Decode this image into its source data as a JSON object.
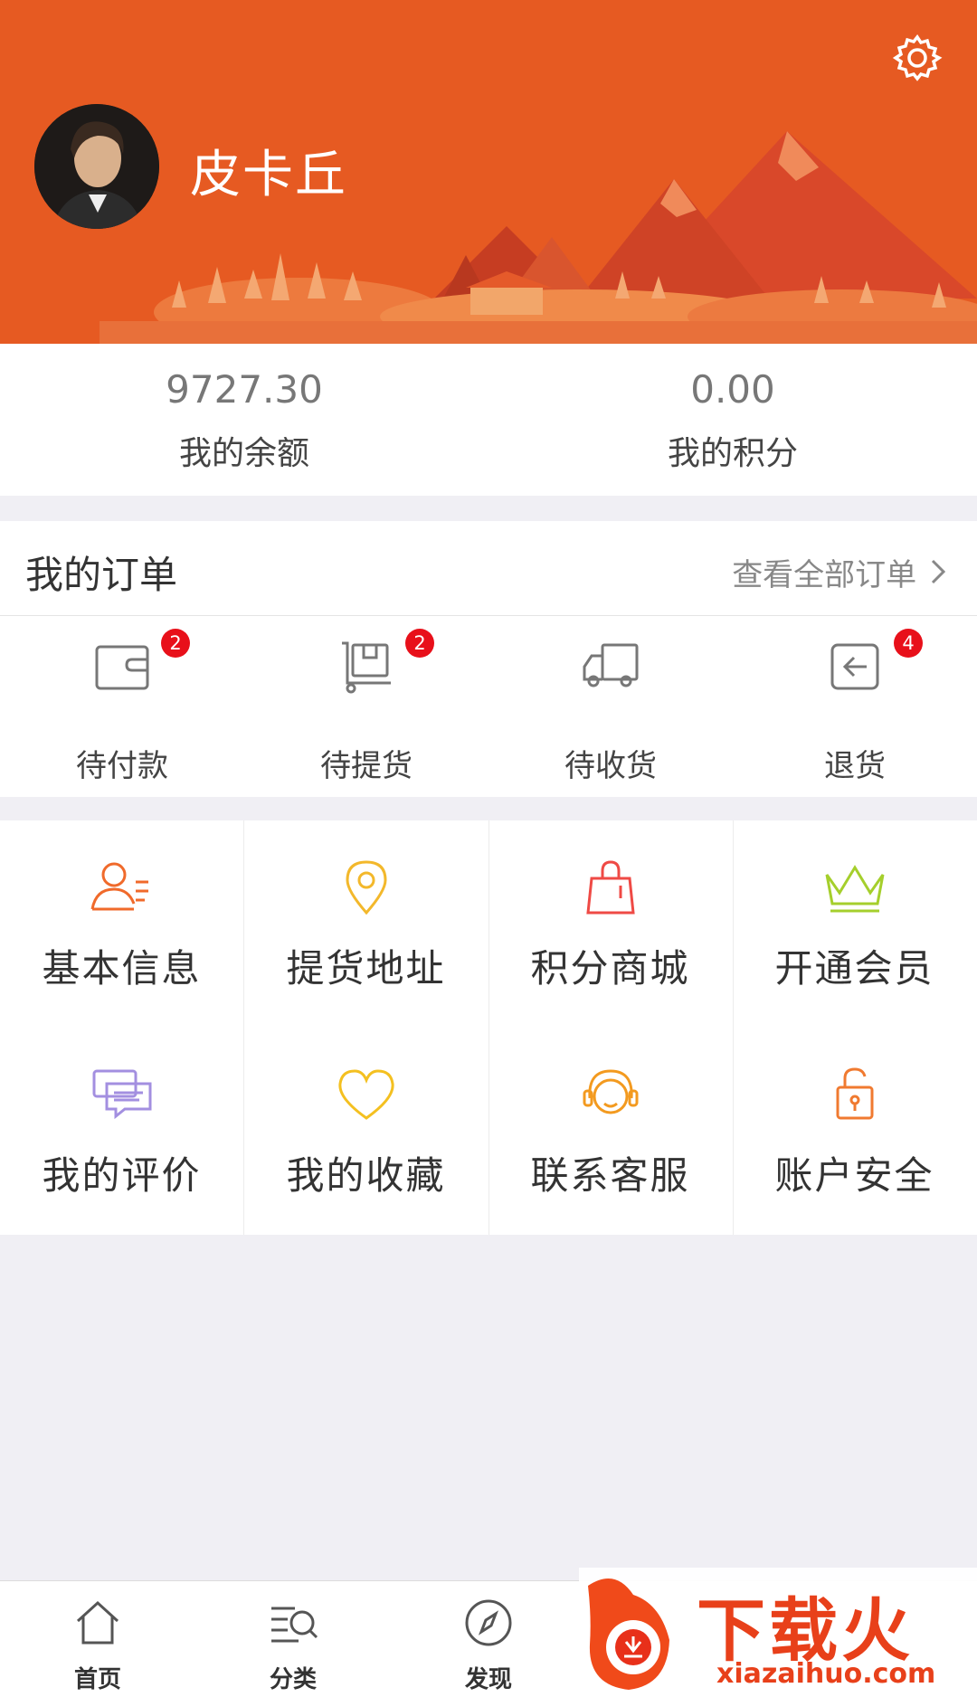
{
  "profile": {
    "username": "皮卡丘"
  },
  "stats": [
    {
      "value": "9727.30",
      "label": "我的余额"
    },
    {
      "value": "0.00",
      "label": "我的积分"
    }
  ],
  "orders": {
    "title": "我的订单",
    "view_all": "查看全部订单",
    "items": [
      {
        "label": "待付款",
        "badge": "2",
        "icon": "wallet-icon"
      },
      {
        "label": "待提货",
        "badge": "2",
        "icon": "pickup-cart-icon"
      },
      {
        "label": "待收货",
        "badge": "",
        "icon": "truck-icon"
      },
      {
        "label": "退货",
        "badge": "4",
        "icon": "return-icon"
      }
    ]
  },
  "menu": [
    {
      "label": "基本信息",
      "icon": "user-info-icon",
      "color": "#f06a2b"
    },
    {
      "label": "提货地址",
      "icon": "location-pin-icon",
      "color": "#f3b82b"
    },
    {
      "label": "积分商城",
      "icon": "shopping-bag-icon",
      "color": "#ef4a45"
    },
    {
      "label": "开通会员",
      "icon": "crown-icon",
      "color": "#a5cf2c"
    },
    {
      "label": "我的评价",
      "icon": "chat-bubbles-icon",
      "color": "#a38fe0"
    },
    {
      "label": "我的收藏",
      "icon": "heart-icon",
      "color": "#f4c020"
    },
    {
      "label": "联系客服",
      "icon": "customer-service-icon",
      "color": "#f39a1f"
    },
    {
      "label": "账户安全",
      "icon": "padlock-icon",
      "color": "#f07a30"
    }
  ],
  "tabbar": [
    {
      "label": "首页",
      "icon": "home-icon"
    },
    {
      "label": "分类",
      "icon": "category-search-icon"
    },
    {
      "label": "发现",
      "icon": "compass-icon"
    }
  ],
  "watermark": {
    "text": "下载火",
    "url": "xiazaihuo.com"
  },
  "colors": {
    "header": "#e65a22",
    "badge": "#e8101a",
    "background": "#f0eff4"
  }
}
